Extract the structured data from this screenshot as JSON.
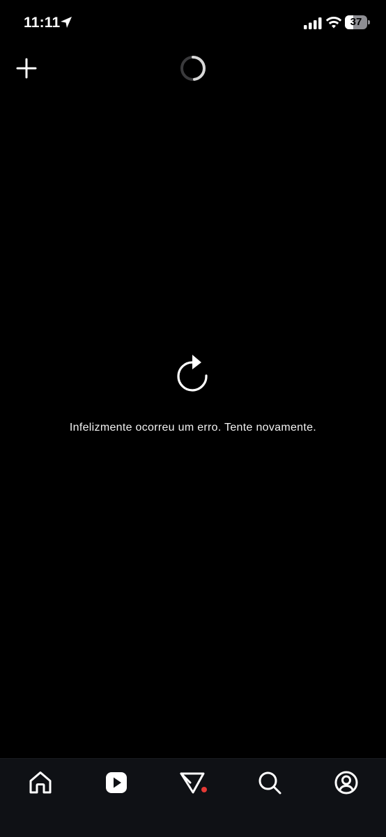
{
  "status_bar": {
    "time": "11:11",
    "battery_level": "37",
    "battery_fraction": 0.37,
    "icons": [
      "location-arrow-icon",
      "cellular-signal-icon",
      "wifi-icon",
      "battery-icon"
    ]
  },
  "header": {
    "add_icon": "plus-icon",
    "loading_icon": "spinner-icon"
  },
  "error_state": {
    "retry_icon": "refresh-icon",
    "message": "Infelizmente ocorreu um erro. Tente novamente."
  },
  "bottom_nav": {
    "items": [
      {
        "id": "home",
        "icon": "home-icon"
      },
      {
        "id": "reels",
        "icon": "play-icon",
        "active": true
      },
      {
        "id": "messages",
        "icon": "paper-plane-icon",
        "has_notification_dot": true
      },
      {
        "id": "search",
        "icon": "search-icon"
      },
      {
        "id": "profile",
        "icon": "profile-icon"
      }
    ]
  },
  "colors": {
    "background": "#000000",
    "nav_background": "#0f1115",
    "notification_dot": "#e53935",
    "text": "#f2f2f2"
  }
}
